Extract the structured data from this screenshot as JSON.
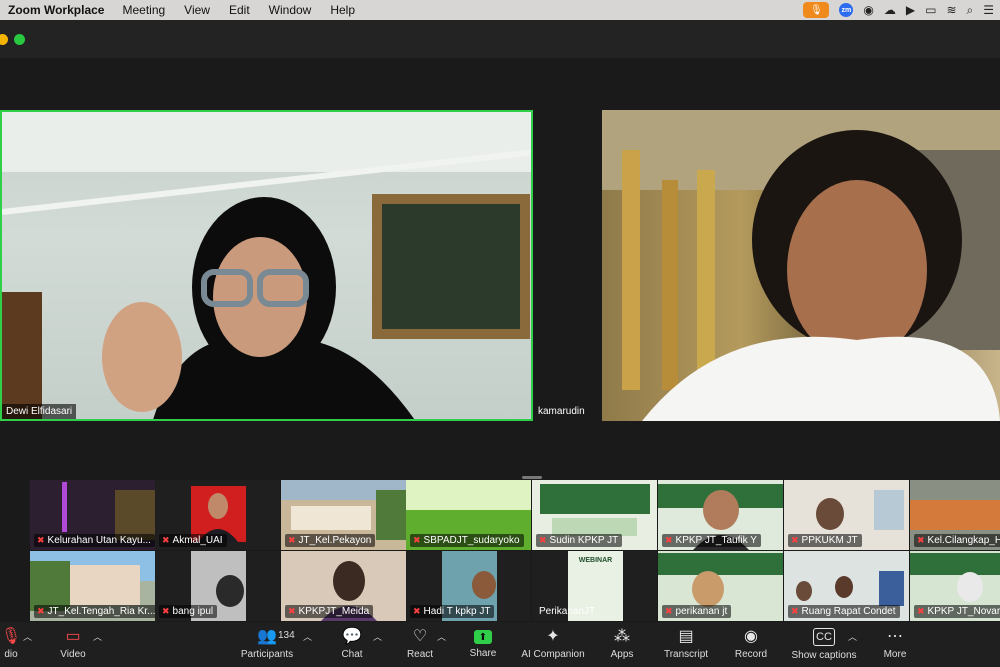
{
  "menubar": {
    "app": "Zoom Workplace",
    "items": [
      "Meeting",
      "View",
      "Edit",
      "Window",
      "Help"
    ],
    "zoom_badge": "zm"
  },
  "main_tiles": [
    {
      "name": "Dewi Elfidasari"
    },
    {
      "name": "kamarudin"
    }
  ],
  "gallery": [
    {
      "name": "Kelurahan Utan Kayu...",
      "color": "#3a2a3e"
    },
    {
      "name": "Akmal_UAI",
      "color": "#ffffff"
    },
    {
      "name": "JT_Kel.Pekayon",
      "color": "#9fb7c9"
    },
    {
      "name": "SBPADJT_sudaryoko",
      "color": "#8fcf5a"
    },
    {
      "name": "Sudin KPKP JT",
      "color": "#e8efe2"
    },
    {
      "name": "KPKP JT_Taufik Y",
      "color": "#dfe9dc"
    },
    {
      "name": "PPKUKM JT",
      "color": "#c9c1b3"
    },
    {
      "name": "Kel.Cilangkap_H...",
      "color": "#8a8f84"
    },
    {
      "name": "JT_Kel.Tengah_Ria Kr...",
      "color": "#a9b4a0"
    },
    {
      "name": "bang ipul",
      "color": "#bfbfbf"
    },
    {
      "name": "KPKPJT_Meida",
      "color": "#7a5a4a"
    },
    {
      "name": "Hadi T kpkp JT",
      "color": "#6ea3ad"
    },
    {
      "name": "PerikananJT",
      "color": "#e9f0e4"
    },
    {
      "name": "perikanan jt",
      "color": "#d9e6d4"
    },
    {
      "name": "Ruang Rapat Condet",
      "color": "#c2cbc9"
    },
    {
      "name": "KPKP JT_Novari...",
      "color": "#d6e5d2"
    }
  ],
  "webinar_text": "WEBINAR",
  "toolbar": {
    "audio": "dio",
    "video": "Video",
    "participants": "Participants",
    "participants_count": "134",
    "chat": "Chat",
    "react": "React",
    "share": "Share",
    "ai": "AI Companion",
    "apps": "Apps",
    "transcript": "Transcript",
    "record": "Record",
    "captions": "Show captions",
    "more": "More"
  },
  "colors": {
    "active_speaker": "#2fcf4a",
    "mute": "#ff4040",
    "mic_pill": "#f08a1c"
  }
}
